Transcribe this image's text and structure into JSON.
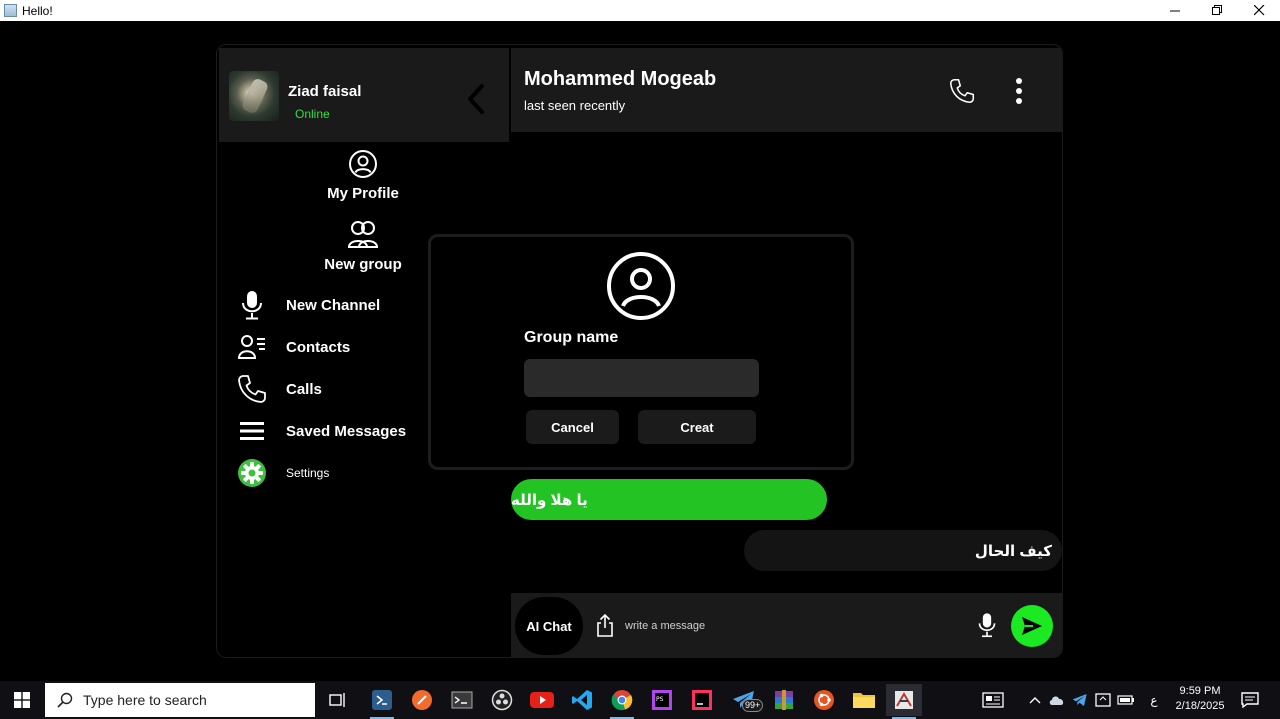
{
  "window": {
    "title": "Hello!"
  },
  "sidebar": {
    "user": {
      "name": "Ziad faisal",
      "status": "Online"
    },
    "my_profile": "My Profile",
    "new_group": "New group",
    "items": [
      {
        "label": "New Channel",
        "icon": "microphone-icon"
      },
      {
        "label": "Contacts",
        "icon": "contacts-icon"
      },
      {
        "label": "Calls",
        "icon": "phone-icon"
      },
      {
        "label": "Saved Messages",
        "icon": "menu-lines-icon"
      },
      {
        "label": "Settings",
        "icon": "gear-icon"
      }
    ]
  },
  "chat": {
    "contact_name": "Mohammed Mogeab",
    "contact_status": "last seen recently",
    "messages": [
      {
        "text": "يا هلا والله",
        "direction": "outgoing"
      },
      {
        "text": "كيف الحال",
        "direction": "incoming"
      }
    ],
    "composer": {
      "ai_chat": "AI Chat",
      "placeholder": "write a message"
    }
  },
  "dialog": {
    "label": "Group name",
    "input_value": "",
    "cancel": "Cancel",
    "create": "Creat"
  },
  "taskbar": {
    "search_placeholder": "Type here to search",
    "telegram_badge": "99+",
    "language": "ع",
    "time": "9:59 PM",
    "date": "2/18/2025"
  },
  "colors": {
    "accent_green": "#22c323",
    "send_green": "#1bea23",
    "online_green": "#2fe03a",
    "panel": "#1a1a1a"
  }
}
